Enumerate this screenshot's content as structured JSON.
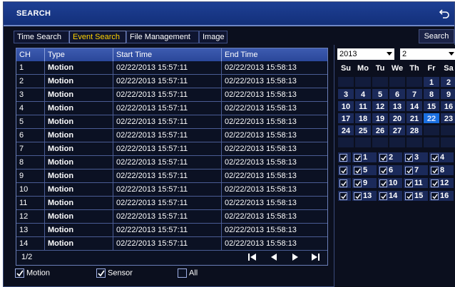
{
  "window": {
    "title": "SEARCH"
  },
  "tabs": [
    {
      "label": "Time Search",
      "active": false
    },
    {
      "label": "Event Search",
      "active": true
    },
    {
      "label": "File Management",
      "active": false
    },
    {
      "label": "Image",
      "active": false
    }
  ],
  "search_button": "Search",
  "table": {
    "headers": [
      "CH",
      "Type",
      "Start Time",
      "End Time"
    ],
    "rows": [
      [
        "1",
        "Motion",
        "02/22/2013 15:57:11",
        "02/22/2013 15:58:13"
      ],
      [
        "2",
        "Motion",
        "02/22/2013 15:57:11",
        "02/22/2013 15:58:13"
      ],
      [
        "3",
        "Motion",
        "02/22/2013 15:57:11",
        "02/22/2013 15:58:13"
      ],
      [
        "4",
        "Motion",
        "02/22/2013 15:57:11",
        "02/22/2013 15:58:13"
      ],
      [
        "5",
        "Motion",
        "02/22/2013 15:57:11",
        "02/22/2013 15:58:13"
      ],
      [
        "6",
        "Motion",
        "02/22/2013 15:57:11",
        "02/22/2013 15:58:13"
      ],
      [
        "7",
        "Motion",
        "02/22/2013 15:57:11",
        "02/22/2013 15:58:13"
      ],
      [
        "8",
        "Motion",
        "02/22/2013 15:57:11",
        "02/22/2013 15:58:13"
      ],
      [
        "9",
        "Motion",
        "02/22/2013 15:57:11",
        "02/22/2013 15:58:13"
      ],
      [
        "10",
        "Motion",
        "02/22/2013 15:57:11",
        "02/22/2013 15:58:13"
      ],
      [
        "11",
        "Motion",
        "02/22/2013 15:57:11",
        "02/22/2013 15:58:13"
      ],
      [
        "12",
        "Motion",
        "02/22/2013 15:57:11",
        "02/22/2013 15:58:13"
      ],
      [
        "13",
        "Motion",
        "02/22/2013 15:57:11",
        "02/22/2013 15:58:13"
      ],
      [
        "14",
        "Motion",
        "02/22/2013 15:57:11",
        "02/22/2013 15:58:13"
      ]
    ],
    "page": "1/2"
  },
  "filters": [
    {
      "label": "Motion",
      "checked": true
    },
    {
      "label": "Sensor",
      "checked": true
    },
    {
      "label": "All",
      "checked": false
    }
  ],
  "calendar": {
    "year": "2013",
    "month": "2",
    "weekdays": [
      "Su",
      "Mo",
      "Tu",
      "We",
      "Th",
      "Fr",
      "Sa"
    ],
    "weeks": [
      [
        "",
        "",
        "",
        "",
        "",
        "1",
        "2"
      ],
      [
        "3",
        "4",
        "5",
        "6",
        "7",
        "8",
        "9"
      ],
      [
        "10",
        "11",
        "12",
        "13",
        "14",
        "15",
        "16"
      ],
      [
        "17",
        "18",
        "19",
        "20",
        "21",
        "22",
        "23"
      ],
      [
        "24",
        "25",
        "26",
        "27",
        "28",
        "",
        ""
      ],
      [
        "",
        "",
        "",
        "",
        "",
        "",
        ""
      ]
    ],
    "selected_day": "22"
  },
  "channels": {
    "rows": [
      [
        "1",
        "2",
        "3",
        "4"
      ],
      [
        "5",
        "6",
        "7",
        "8"
      ],
      [
        "9",
        "10",
        "11",
        "12"
      ],
      [
        "13",
        "14",
        "15",
        "16"
      ]
    ]
  },
  "icons": {
    "back": "back-arrow-icon",
    "first": "first-page-icon",
    "prev": "previous-page-icon",
    "next": "next-page-icon",
    "last": "last-page-icon",
    "check": "check-icon"
  },
  "colors": {
    "titlebar": "#1e3f94",
    "active_tab_text": "#ffd200",
    "selected_day": "#1a6fe0",
    "table_header": "#3d5bb0"
  }
}
